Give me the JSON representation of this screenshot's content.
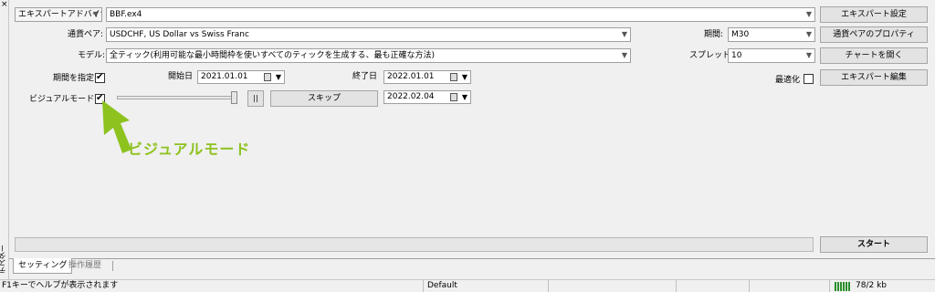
{
  "sidebar": {
    "close_glyph": "×",
    "title": "テスター"
  },
  "top": {
    "expert_label": "エキスパートアドバイザ",
    "expert_value": "BBF.ex4",
    "expert_settings_btn": "エキスパート設定"
  },
  "row_symbol": {
    "label": "通貨ペア:",
    "value": "USDCHF, US Dollar vs Swiss Franc",
    "period_label": "期間:",
    "period_value": "M30",
    "symbol_props_btn": "通貨ペアのプロパティ"
  },
  "row_model": {
    "label": "モデル:",
    "value": "全ティック(利用可能な最小時間枠を使いすべてのティックを生成する、最も正確な方法)",
    "spread_label": "スプレッド:",
    "spread_value": "10",
    "open_chart_btn": "チャートを開く"
  },
  "row_dates": {
    "use_date_label": "期間を指定",
    "use_date_checked": true,
    "start_label": "開始日",
    "start_value": "2021.01.01",
    "end_label": "終了日",
    "end_value": "2022.01.01",
    "optimize_label": "最適化",
    "optimize_checked": false,
    "edit_expert_btn": "エキスパート編集"
  },
  "row_visual": {
    "label": "ビジュアルモード",
    "checked": true,
    "pause_glyph": "||",
    "skip_btn": "スキップ",
    "skip_date": "2022.02.04"
  },
  "annotation": {
    "text": "ビジュアルモード",
    "color": "#8dc21f"
  },
  "start_btn": "スタート",
  "tabs": [
    {
      "label": "セッティング",
      "active": true
    },
    {
      "label": "操作履歴",
      "active": false
    }
  ],
  "status": {
    "help": "F1キーでヘルプが表示されます",
    "profile": "Default",
    "traffic": "78/2 kb"
  }
}
